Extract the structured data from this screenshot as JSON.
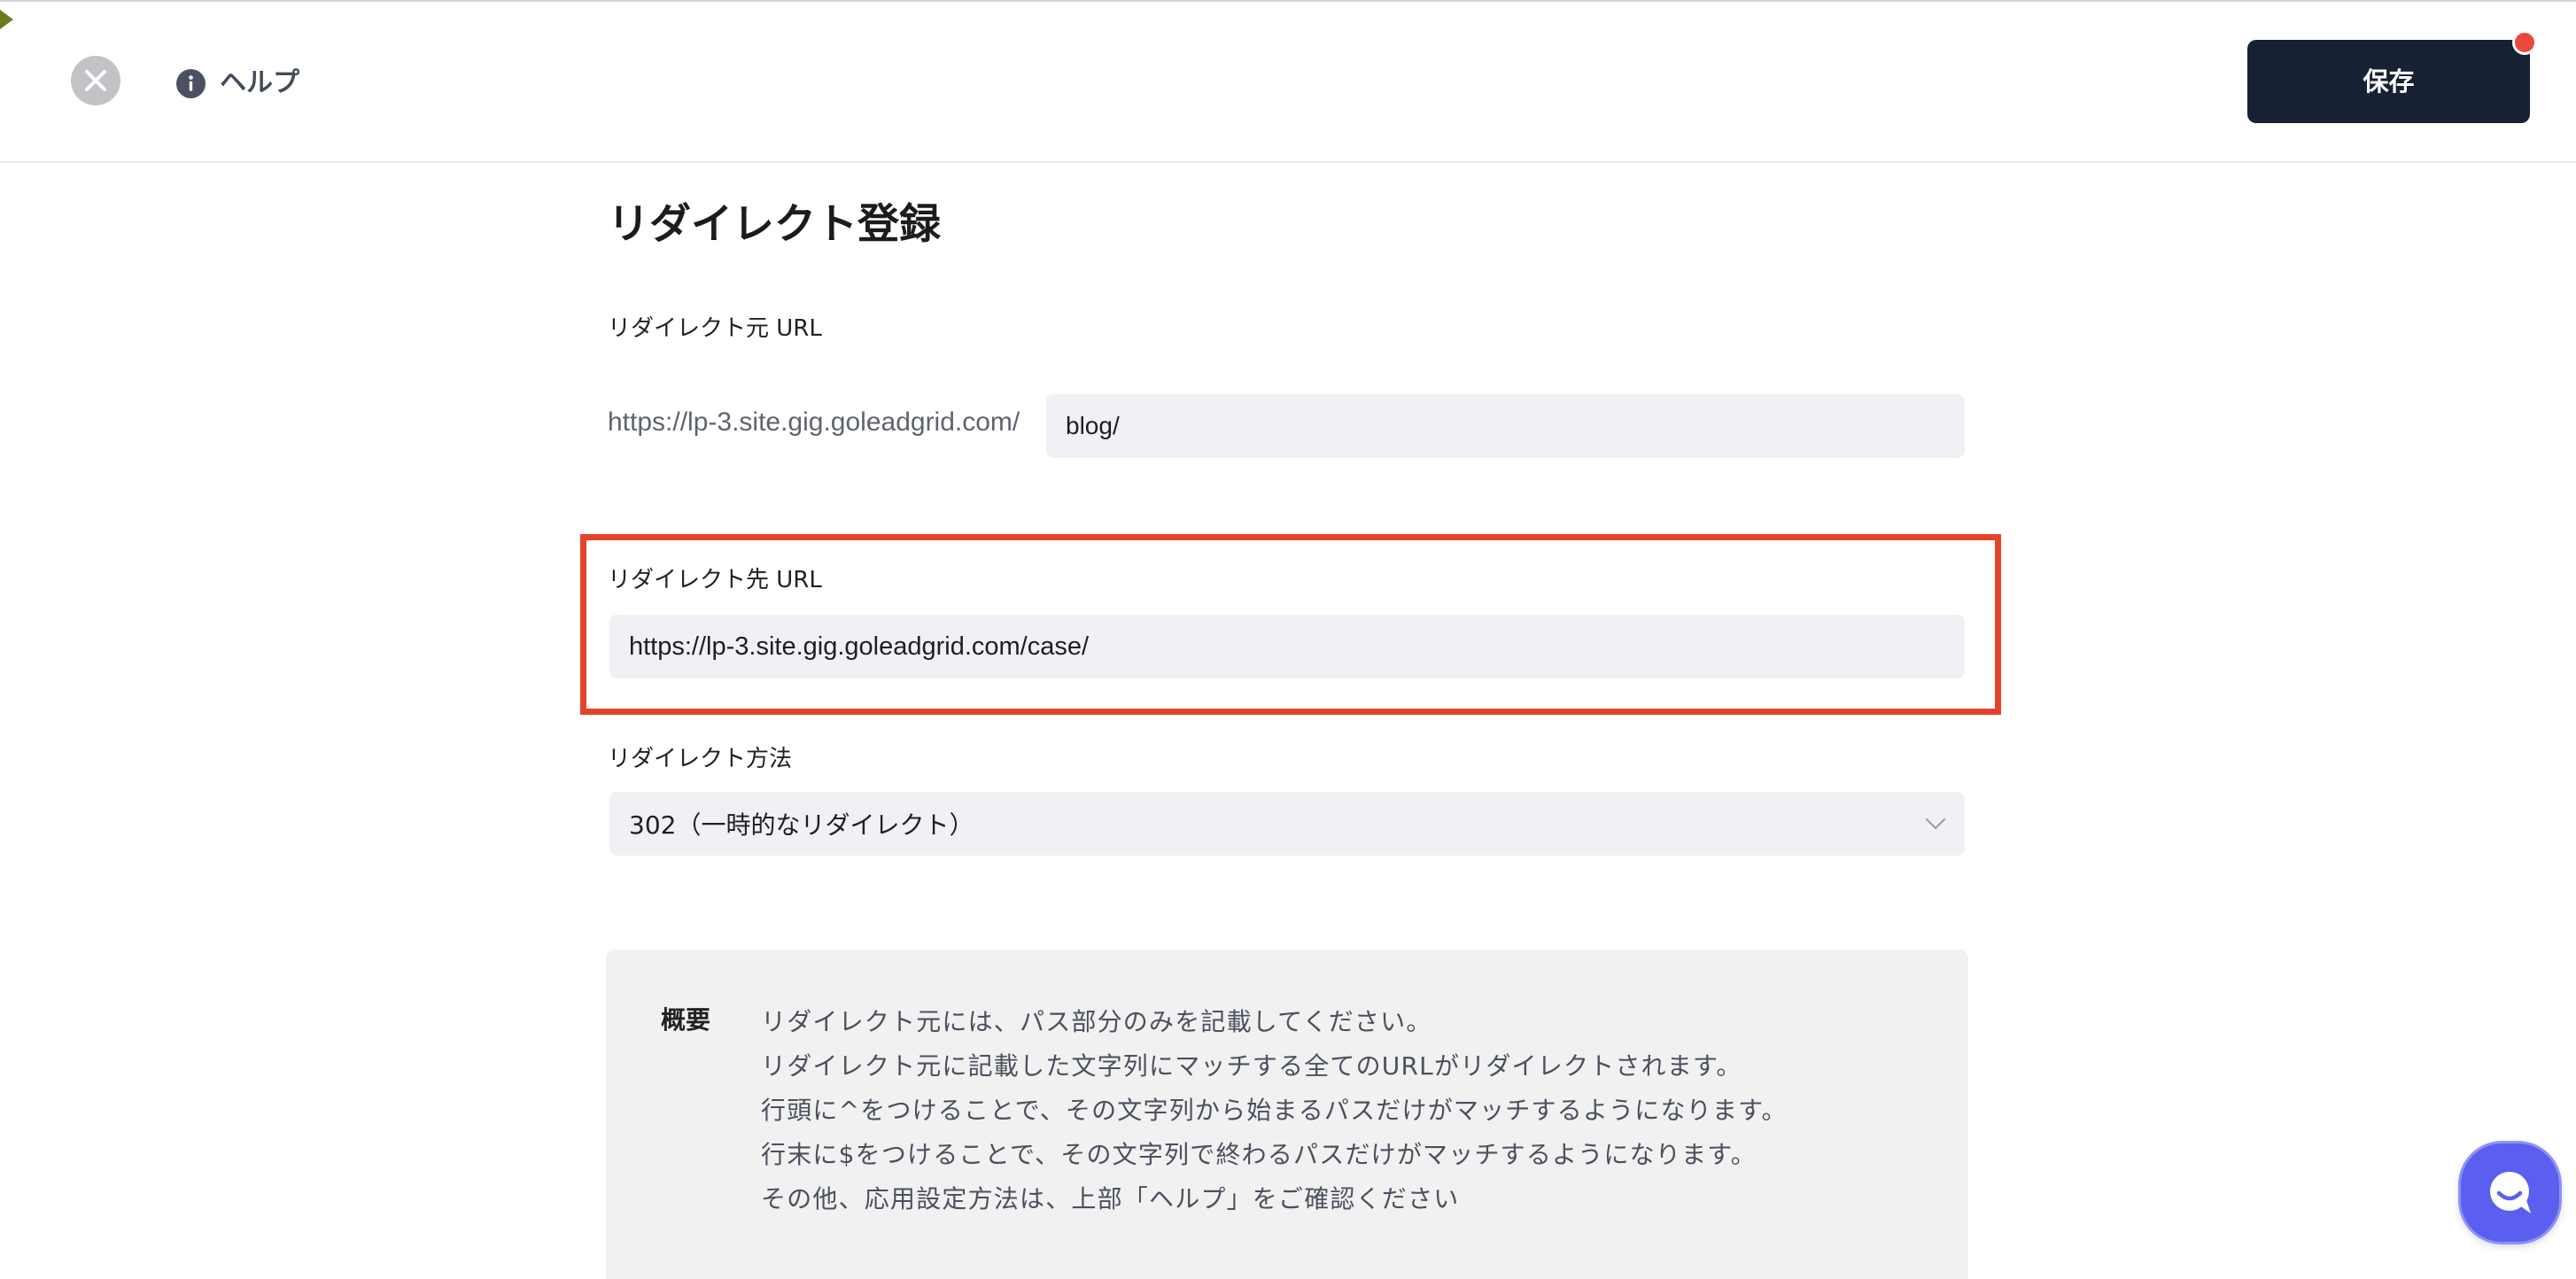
{
  "header": {
    "close_icon": "close-icon",
    "help_icon": "info-icon",
    "help_label": "ヘルプ",
    "save_label": "保存"
  },
  "page": {
    "title": "リダイレクト登録"
  },
  "form": {
    "source_url": {
      "label": "リダイレクト元 URL",
      "prefix": "https://lp-3.site.gig.goleadgrid.com/",
      "value": "blog/"
    },
    "destination_url": {
      "label": "リダイレクト先 URL",
      "value": "https://lp-3.site.gig.goleadgrid.com/case/"
    },
    "redirect_method": {
      "label": "リダイレクト方法",
      "selected": "302（一時的なリダイレクト）",
      "icon": "chevron-down-icon"
    }
  },
  "overview": {
    "heading": "概要",
    "lines": [
      "リダイレクト元には、パス部分のみを記載してください。",
      "リダイレクト元に記載した文字列にマッチする全てのURLがリダイレクトされます。",
      "行頭に^をつけることで、その文字列から始まるパスだけがマッチするようになります。",
      "行末に$をつけることで、その文字列で終わるパスだけがマッチするようになります。",
      "その他、応用設定方法は、上部「ヘルプ」をご確認ください"
    ]
  },
  "chat": {
    "icon": "chat-smile-icon"
  },
  "colors": {
    "save-bg": "#172134",
    "dot": "#e9493a",
    "highlight": "#e4432b",
    "chat-bg": "#5a5ff0",
    "input-bg": "#f1f1f5"
  }
}
